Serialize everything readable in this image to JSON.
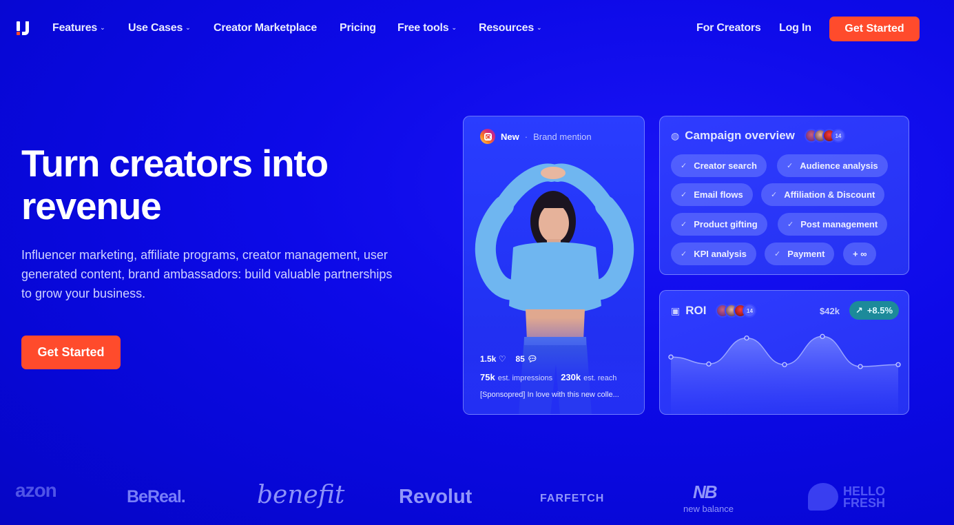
{
  "nav": {
    "items": [
      {
        "label": "Features",
        "dropdown": true
      },
      {
        "label": "Use Cases",
        "dropdown": true
      },
      {
        "label": "Creator Marketplace",
        "dropdown": false
      },
      {
        "label": "Pricing",
        "dropdown": false
      },
      {
        "label": "Free tools",
        "dropdown": true
      },
      {
        "label": "Resources",
        "dropdown": true
      }
    ],
    "for_creators": "For Creators",
    "login": "Log In",
    "cta": "Get Started"
  },
  "hero": {
    "title_line1": "Turn creators into",
    "title_line2": "revenue",
    "subtitle": "Influencer marketing, affiliate programs, creator management, user generated content, brand ambassadors: build valuable partnerships to grow your business.",
    "cta": "Get Started"
  },
  "post": {
    "new_label": "New",
    "separator": "·",
    "tag": "Brand mention",
    "likes": "1.5k",
    "comments": "85",
    "impressions_value": "75k",
    "impressions_label": "est. impressions",
    "reach_value": "230k",
    "reach_label": "est. reach",
    "caption": "[Sponsopred] In love with this new colle..."
  },
  "campaign": {
    "title": "Campaign overview",
    "avatar_count": "14",
    "chips": [
      "Creator search",
      "Audience analysis",
      "Email flows",
      "Affiliation & Discount",
      "Product gifting",
      "Post management",
      "KPI analysis",
      "Payment",
      "+ ∞"
    ]
  },
  "roi": {
    "title": "ROI",
    "avatar_count": "14",
    "amount": "$42k",
    "change": "+8.5%",
    "points": [
      0.3,
      0.08,
      0.9,
      0.06,
      0.95,
      0.0,
      0.06
    ]
  },
  "brands": [
    "azon",
    "BeReal.",
    "benefit",
    "Revolut",
    "FARFETCH",
    "new balance",
    "HELLO FRESH"
  ],
  "colors": {
    "accent": "#ff4b2c",
    "background": "#0a0ae0",
    "roi_badge": "#1c8a9a"
  }
}
